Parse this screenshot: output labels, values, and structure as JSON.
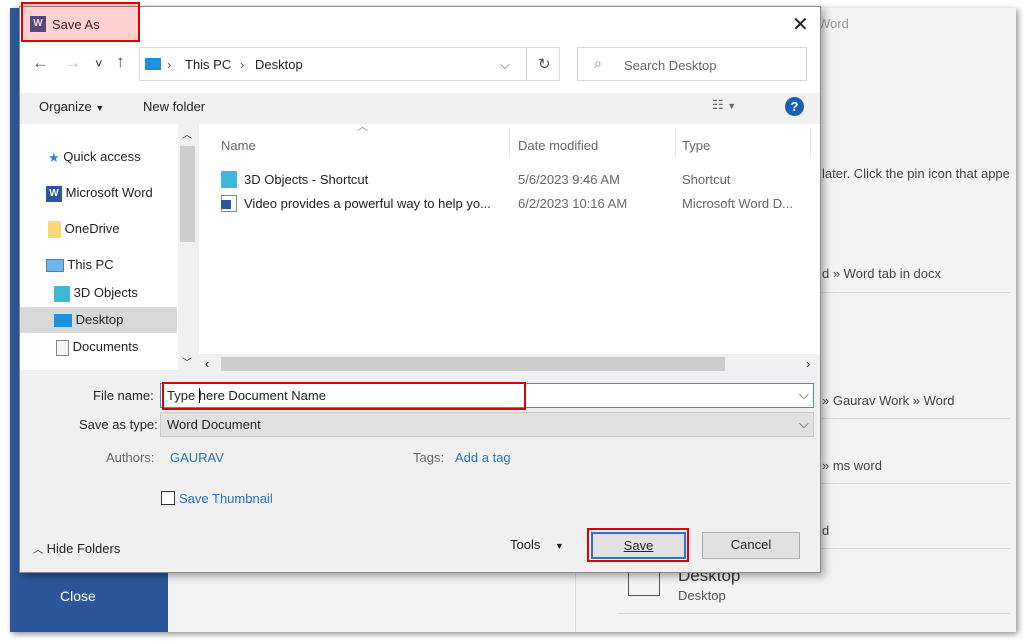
{
  "background": {
    "close_label": "Close",
    "fragments": [
      "Word",
      "later. Click the pin icon that appe",
      "d » Word tab in docx",
      "» Gaurav Work » Word",
      "» ms word",
      "d"
    ],
    "desktop_title": "Desktop",
    "desktop_sub": "Desktop"
  },
  "dialog": {
    "title": "Save As",
    "address": {
      "crumbs": [
        "This PC",
        "Desktop"
      ]
    },
    "search_placeholder": "Search Desktop",
    "toolbar": {
      "organize": "Organize",
      "new_folder": "New folder"
    },
    "nav": [
      {
        "label": "Quick access",
        "icon": "star-icon"
      },
      {
        "label": "Microsoft Word",
        "icon": "word-icon"
      },
      {
        "label": "OneDrive",
        "icon": "folder-icon"
      },
      {
        "label": "This PC",
        "icon": "computer-icon"
      },
      {
        "label": "3D Objects",
        "icon": "cube-icon"
      },
      {
        "label": "Desktop",
        "icon": "desktop-icon",
        "selected": true
      },
      {
        "label": "Documents",
        "icon": "document-icon"
      }
    ],
    "columns": [
      "Name",
      "Date modified",
      "Type"
    ],
    "files": [
      {
        "name": "3D Objects - Shortcut",
        "date": "5/6/2023 9:46 AM",
        "type": "Shortcut",
        "icon": "shortcut-icon"
      },
      {
        "name": "Video provides a powerful way to help yo...",
        "date": "6/2/2023 10:16 AM",
        "type": "Microsoft Word D...",
        "icon": "word-doc-icon"
      }
    ],
    "file_name_label": "File name:",
    "file_name_value": "Type here Document Name",
    "save_type_label": "Save as type:",
    "save_type_value": "Word Document",
    "authors_label": "Authors:",
    "authors_value": "GAURAV",
    "tags_label": "Tags:",
    "tags_value": "Add a tag",
    "thumbnail_label": "Save Thumbnail",
    "thumbnail_checked": false,
    "hide_folders": "Hide Folders",
    "tools": "Tools",
    "save": "Save",
    "cancel": "Cancel"
  },
  "colors": {
    "accent": "#2a73c5",
    "word_blue": "#2b579a",
    "highlight": "#e00000"
  }
}
